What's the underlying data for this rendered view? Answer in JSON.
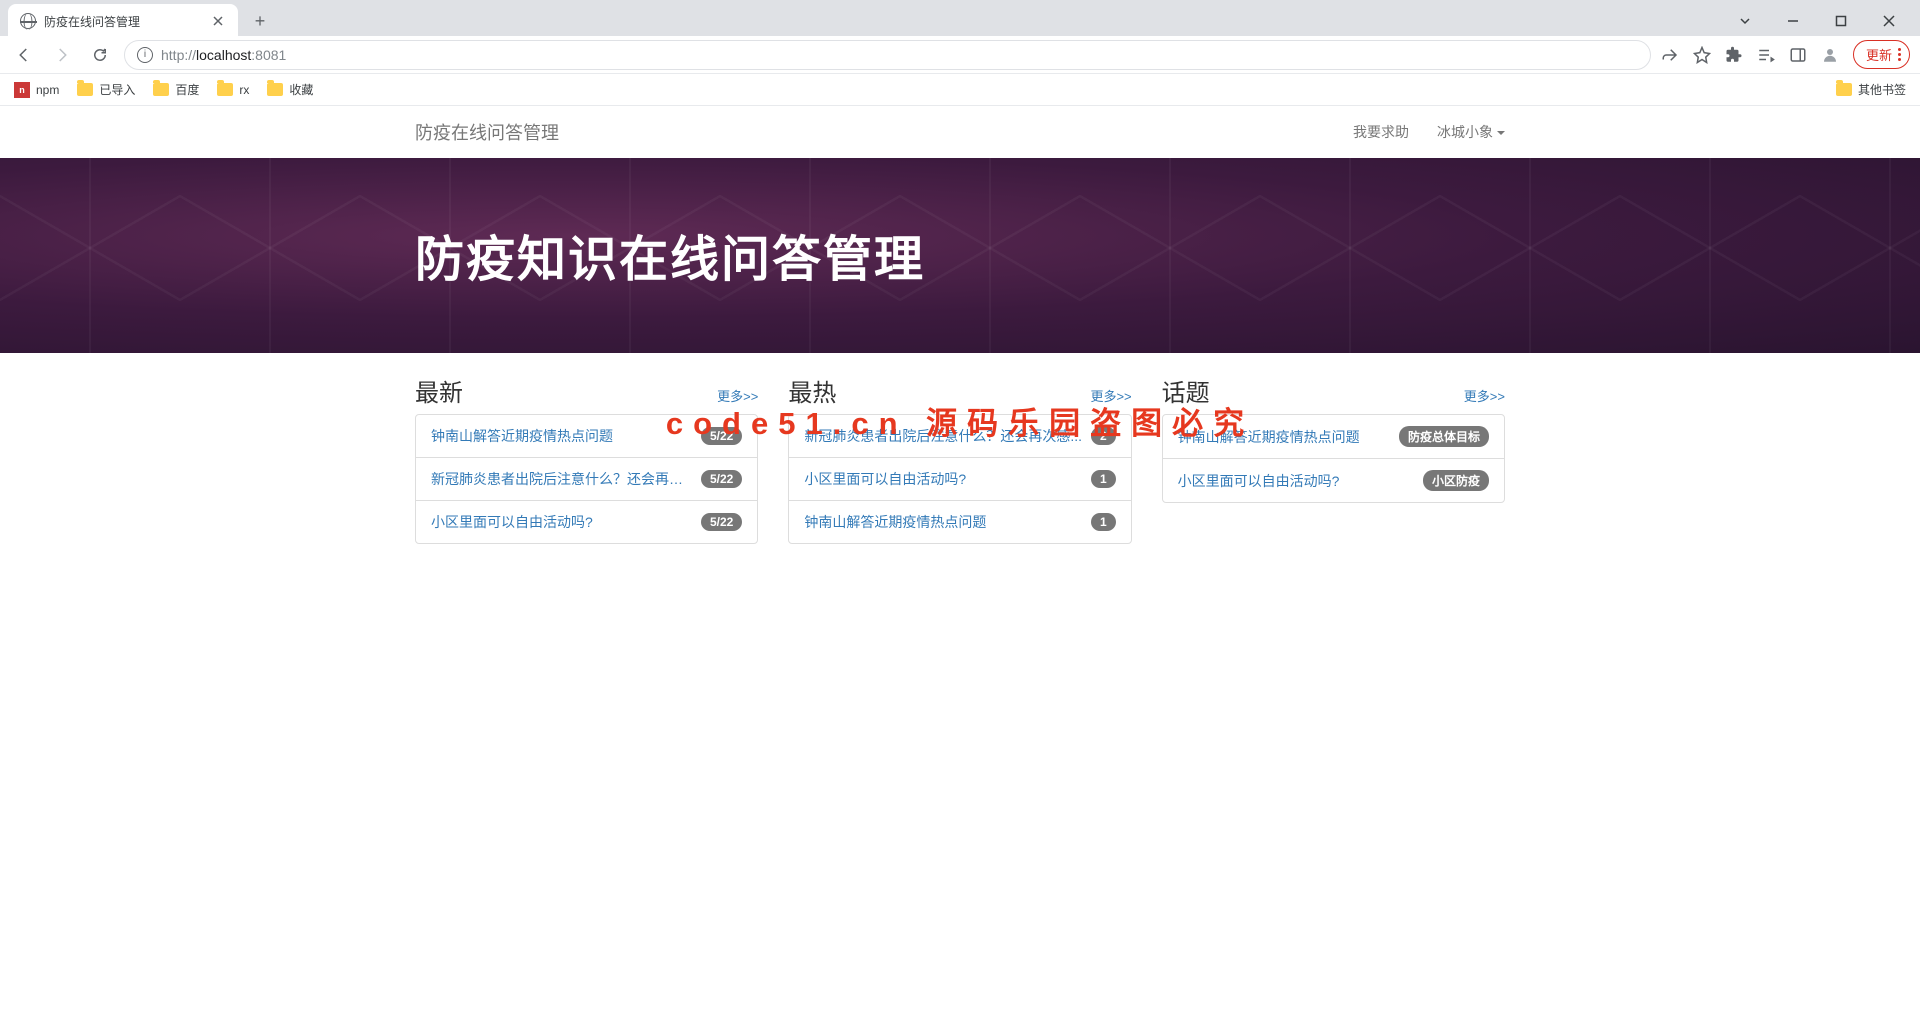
{
  "browser": {
    "tab_title": "防疫在线问答管理",
    "url_grey": "http://",
    "url_host": "localhost",
    "url_port": ":8081",
    "update_label": "更新",
    "bookmarks": [
      "npm",
      "已导入",
      "百度",
      "rx",
      "收藏"
    ],
    "other_bookmarks": "其他书签"
  },
  "nav": {
    "brand": "防疫在线问答管理",
    "help": "我要求助",
    "user": "冰城小象"
  },
  "hero": {
    "title": "防疫知识在线问答管理"
  },
  "columns": {
    "latest": {
      "title": "最新",
      "more": "更多>>",
      "items": [
        {
          "text": "钟南山解答近期疫情热点问题",
          "badge": "5/22"
        },
        {
          "text": "新冠肺炎患者出院后注意什么？还会再次感...",
          "badge": "5/22"
        },
        {
          "text": "小区里面可以自由活动吗?",
          "badge": "5/22"
        }
      ]
    },
    "hot": {
      "title": "最热",
      "more": "更多>>",
      "items": [
        {
          "text": "新冠肺炎患者出院后注意什么？还会再次感...",
          "badge": "2"
        },
        {
          "text": "小区里面可以自由活动吗?",
          "badge": "1"
        },
        {
          "text": "钟南山解答近期疫情热点问题",
          "badge": "1"
        }
      ]
    },
    "topics": {
      "title": "话题",
      "more": "更多>>",
      "items": [
        {
          "text": "钟南山解答近期疫情热点问题",
          "badge": "防疫总体目标"
        },
        {
          "text": "小区里面可以自由活动吗?",
          "badge": "小区防疫"
        }
      ]
    }
  },
  "watermark": "code51.cn 源码乐园盗图必究"
}
